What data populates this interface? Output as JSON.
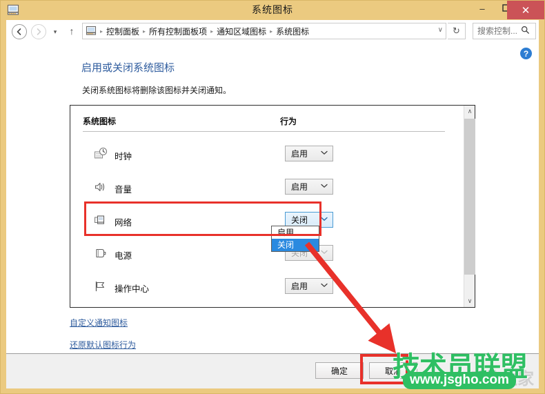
{
  "window": {
    "title": "系统图标",
    "icon": "monitor-icon",
    "minimize_label": "–",
    "maximize_label": "❐",
    "close_label": "✕"
  },
  "navbar": {
    "back_label": "←",
    "forward_label": "→",
    "recent_label": "▾",
    "up_label": "↑",
    "address_icon": "monitor-icon",
    "breadcrumbs": [
      "控制面板",
      "所有控制面板项",
      "通知区域图标",
      "系统图标"
    ],
    "separator": "▸",
    "address_chevron": "∨",
    "refresh_label": "↻",
    "search_placeholder": "搜索控制...",
    "search_value": "",
    "search_icon": "search-icon"
  },
  "page": {
    "help_label": "?",
    "heading": "启用或关闭系统图标",
    "subtext": "关闭系统图标将删除该图标并关闭通知。"
  },
  "table": {
    "columns": [
      "系统图标",
      "行为"
    ],
    "rows": [
      {
        "icon": "clock-icon",
        "label": "时钟",
        "behavior": "启用",
        "state": "normal"
      },
      {
        "icon": "volume-icon",
        "label": "音量",
        "behavior": "启用",
        "state": "normal"
      },
      {
        "icon": "network-icon",
        "label": "网络",
        "behavior": "关闭",
        "state": "focused"
      },
      {
        "icon": "power-icon",
        "label": "电源",
        "behavior": "关闭",
        "state": "dimmed"
      },
      {
        "icon": "action-center-icon",
        "label": "操作中心",
        "behavior": "启用",
        "state": "normal"
      }
    ]
  },
  "dropdown": {
    "open": true,
    "options": [
      "启用",
      "关闭"
    ],
    "selected": "关闭"
  },
  "scrollbar": {
    "up_label": "∧",
    "down_label": "∨"
  },
  "links": {
    "customize": "自定义通知图标",
    "restore": "还原默认图标行为"
  },
  "buttons": {
    "ok": "确定",
    "cancel": "取消"
  },
  "annotations": {
    "highlight_color": "#e8312a",
    "arrow_color": "#e8312a"
  },
  "watermark": {
    "brand": "技术员联盟",
    "url": "www.jsgho.com",
    "gray_text": "Win7系统之家",
    "green": "#2fbf63"
  }
}
